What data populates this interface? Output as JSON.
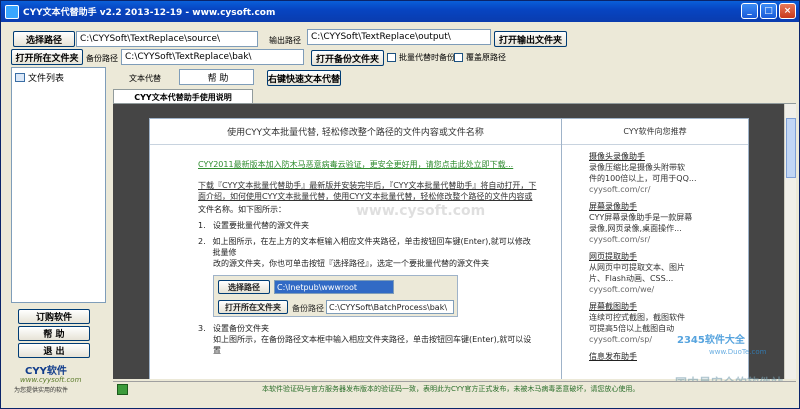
{
  "window": {
    "title": "CYY文本代替助手 v2.2 2013-12-19 - www.cysoft.com"
  },
  "toolbar": {
    "select_path": "选择路径",
    "source_path": "C:\\CYYSoft\\TextReplace\\source\\",
    "output_label": "输出路径",
    "output_path": "C:\\CYYSoft\\TextReplace\\output\\",
    "open_output": "打开输出文件夹",
    "open_folder": "打开所在文件夹",
    "backup_label": "备份路径",
    "backup_path": "C:\\CYYSoft\\TextReplace\\bak\\",
    "open_backup": "打开备份文件夹",
    "chk_batch_backup": "批量代替时备份",
    "chk_overwrite": "覆盖原路径",
    "text_replace_label": "文本代替",
    "help_field": "帮        助",
    "right_quick": "右键快速文本代替"
  },
  "sidebar": {
    "file_list": "文件列表",
    "btn_order": "订购软件",
    "btn_help": "帮    助",
    "btn_exit": "退    出",
    "brand": "CYY软件",
    "brand_url": "www.cyysoft.com",
    "brand_slogan": "为您提供实用的软件"
  },
  "tab": {
    "label": "CYY文本代替助手使用说明"
  },
  "doc": {
    "heading": "使用CYY文本批量代替, 轻松修改整个路径的文件内容或文件名称",
    "notice": "CYY2011最新版本加入防木马恶意病毒云验证，更安全更好用，请您点击此处立即下载...",
    "intro": "下载『CYY文本批量代替助手』最新版并安装完毕后，『CYY文本批量代替助手』将自动打开，下面介绍，如何使用CYY文本批量代替，使用CYY文本批量代替，轻松修改整个路径的文件内容或",
    "intro2": "文件名称。如下图所示：",
    "step1": "设置要批量代替的源文件夹",
    "step2a": "如上图所示，在左上方的文本框输入相应文件夹路径，单击按钮回车键(Enter),就可以修改批量修",
    "step2b": "改的源文件夹，你也可单击按钮『选择路径』，选定一个要批量代替的源文件夹",
    "shot_select": "选择路径",
    "shot_path": "C:\\Inetpub\\wwwroot",
    "shot_open": "打开所在文件夹",
    "shot_backup_label": "备份路径",
    "shot_backup_path": "C:\\CYYSoft\\BatchProcess\\bak\\",
    "step3": "设置备份文件夹",
    "step3a": "如上图所示，在备份路径文本框中输入相应文件夹路径，单击按钮回车键(Enter),就可以设置",
    "n1": "1.",
    "n2": "2.",
    "n3": "3.",
    "side_title": "CYY软件向您推荐",
    "recs": [
      {
        "title": "摄像头录像助手",
        "d1": "录像压缩比是摄像头附带软",
        "d2": "件的100倍以上，可用于QQ...",
        "url": "cyysoft.com/cr/"
      },
      {
        "title": "屏幕录像助手",
        "d1": "CYY屏幕录像助手是一款屏幕",
        "d2": "录像,网页录像,桌面操作...",
        "url": "cyysoft.com/sr/"
      },
      {
        "title": "网页提取助手",
        "d1": "从网页中可提取文本、图片",
        "d2": "片、Flash动画、CSS...",
        "url": "cyysoft.com/we/"
      },
      {
        "title": "屏幕截图助手",
        "d1": "连续可控式截图，截图软件",
        "d2": "可提高5倍以上截图自动",
        "url": "cyysoft.com/sp/"
      },
      {
        "title": "信息发布助手",
        "d1": "",
        "d2": "",
        "url": ""
      }
    ]
  },
  "watermarks": {
    "w1": "2345软件大全",
    "w2": "www.DuoTe.com",
    "w3": "国内最安全的软件站",
    "w4": "www.cysoft.com"
  },
  "status": {
    "text": "本软件验证码与官方服务器发布版本的验证码一致，表明此为CYY官方正式发布，未被木马病毒恶意破坏，请您放心使用。"
  }
}
